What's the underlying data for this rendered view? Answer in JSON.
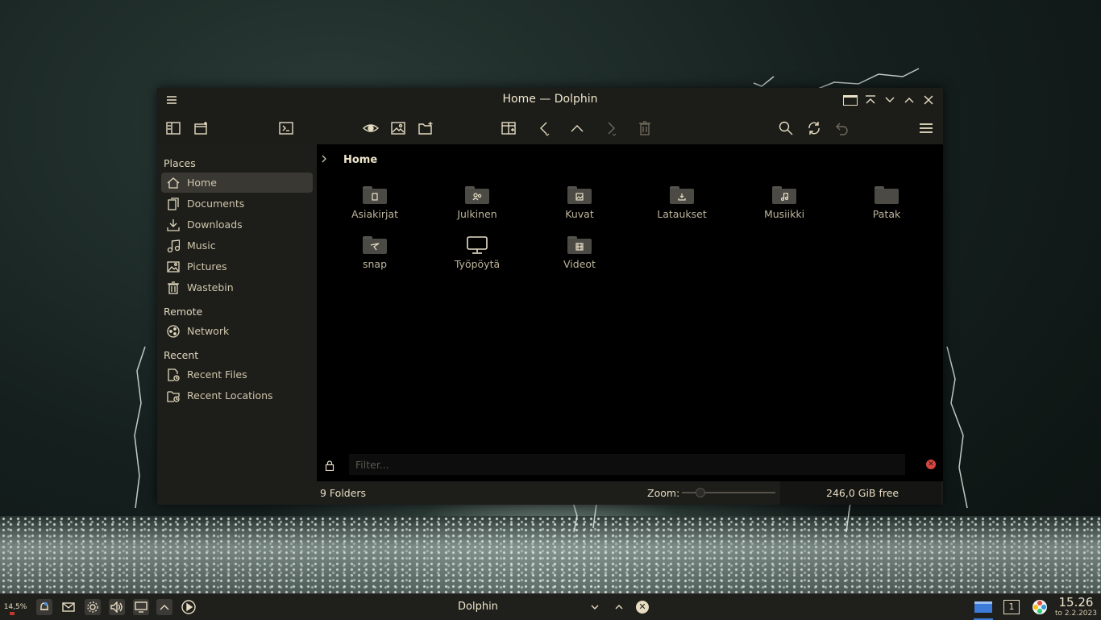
{
  "window": {
    "title": "Home — Dolphin"
  },
  "sidebar": {
    "sections": [
      {
        "label": "Places"
      },
      {
        "label": "Remote"
      },
      {
        "label": "Recent"
      }
    ],
    "items": [
      {
        "label": "Home",
        "icon": "home-icon",
        "selected": true
      },
      {
        "label": "Documents",
        "icon": "documents-icon"
      },
      {
        "label": "Downloads",
        "icon": "downloads-icon"
      },
      {
        "label": "Music",
        "icon": "music-icon"
      },
      {
        "label": "Pictures",
        "icon": "pictures-icon"
      },
      {
        "label": "Wastebin",
        "icon": "wastebin-icon"
      },
      {
        "label": "Network",
        "icon": "network-icon"
      },
      {
        "label": "Recent Files",
        "icon": "recent-files-icon"
      },
      {
        "label": "Recent Locations",
        "icon": "recent-locations-icon"
      }
    ]
  },
  "location": {
    "current": "Home"
  },
  "folders": [
    {
      "name": "Asiakirjat",
      "icon": "document-folder-icon"
    },
    {
      "name": "Julkinen",
      "icon": "public-folder-icon"
    },
    {
      "name": "Kuvat",
      "icon": "pictures-folder-icon"
    },
    {
      "name": "Lataukset",
      "icon": "downloads-folder-icon"
    },
    {
      "name": "Musiikki",
      "icon": "music-folder-icon"
    },
    {
      "name": "Patak",
      "icon": "folder-icon"
    },
    {
      "name": "snap",
      "icon": "snap-folder-icon"
    },
    {
      "name": "Työpöytä",
      "icon": "desktop-icon"
    },
    {
      "name": "Videot",
      "icon": "videos-folder-icon"
    }
  ],
  "filter": {
    "placeholder": "Filter..."
  },
  "status": {
    "summary": "9 Folders",
    "zoom_label": "Zoom:",
    "free_space": "246,0 GiB free"
  },
  "taskbar": {
    "cpu": "14,5%",
    "task_label": "Dolphin",
    "desktop_number": "1",
    "time": "15.26",
    "date": "to 2.2.2023"
  },
  "colors": {
    "accent_close": "#d9463f",
    "text": "#e6dcc1",
    "selection": "#3a3833"
  }
}
